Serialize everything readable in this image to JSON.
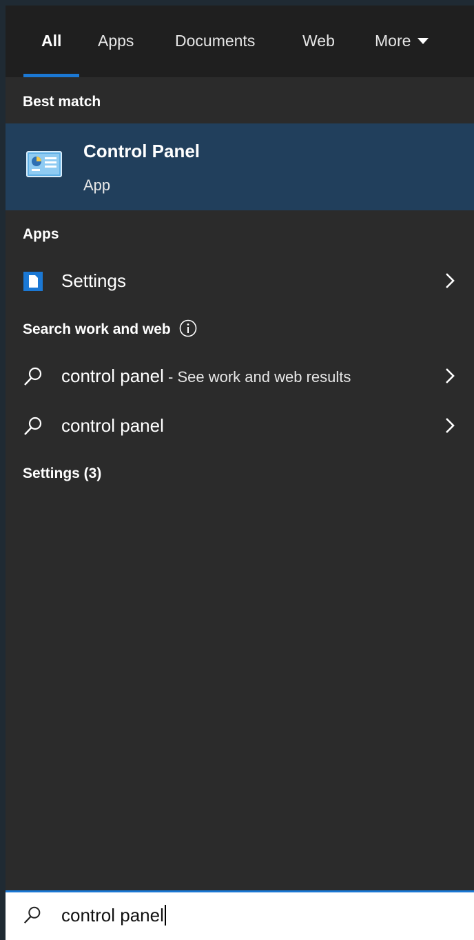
{
  "tabs": [
    {
      "label": "All",
      "active": true
    },
    {
      "label": "Apps",
      "active": false
    },
    {
      "label": "Documents",
      "active": false
    },
    {
      "label": "Web",
      "active": false
    },
    {
      "label": "More",
      "active": false
    }
  ],
  "colors": {
    "accent": "#1b78d4",
    "selected_background": "#213f5c",
    "panel_background": "#2b2b2b",
    "tabbar_background": "#1f1f1f"
  },
  "best_match": {
    "heading": "Best match",
    "title": "Control Panel",
    "subtitle": "App",
    "icon": "control-panel-icon"
  },
  "apps": {
    "heading": "Apps",
    "items": [
      {
        "label": "Settings",
        "icon": "settings-app-icon"
      }
    ]
  },
  "search_web": {
    "heading": "Search work and web",
    "info_icon": "info-icon",
    "items": [
      {
        "label": "control panel",
        "suffix": " - See work and web results",
        "icon": "search-icon"
      },
      {
        "label": "control panel",
        "suffix": "",
        "icon": "search-icon"
      }
    ]
  },
  "settings_heading": "Settings (3)",
  "search": {
    "value": "control panel",
    "icon": "search-icon"
  }
}
